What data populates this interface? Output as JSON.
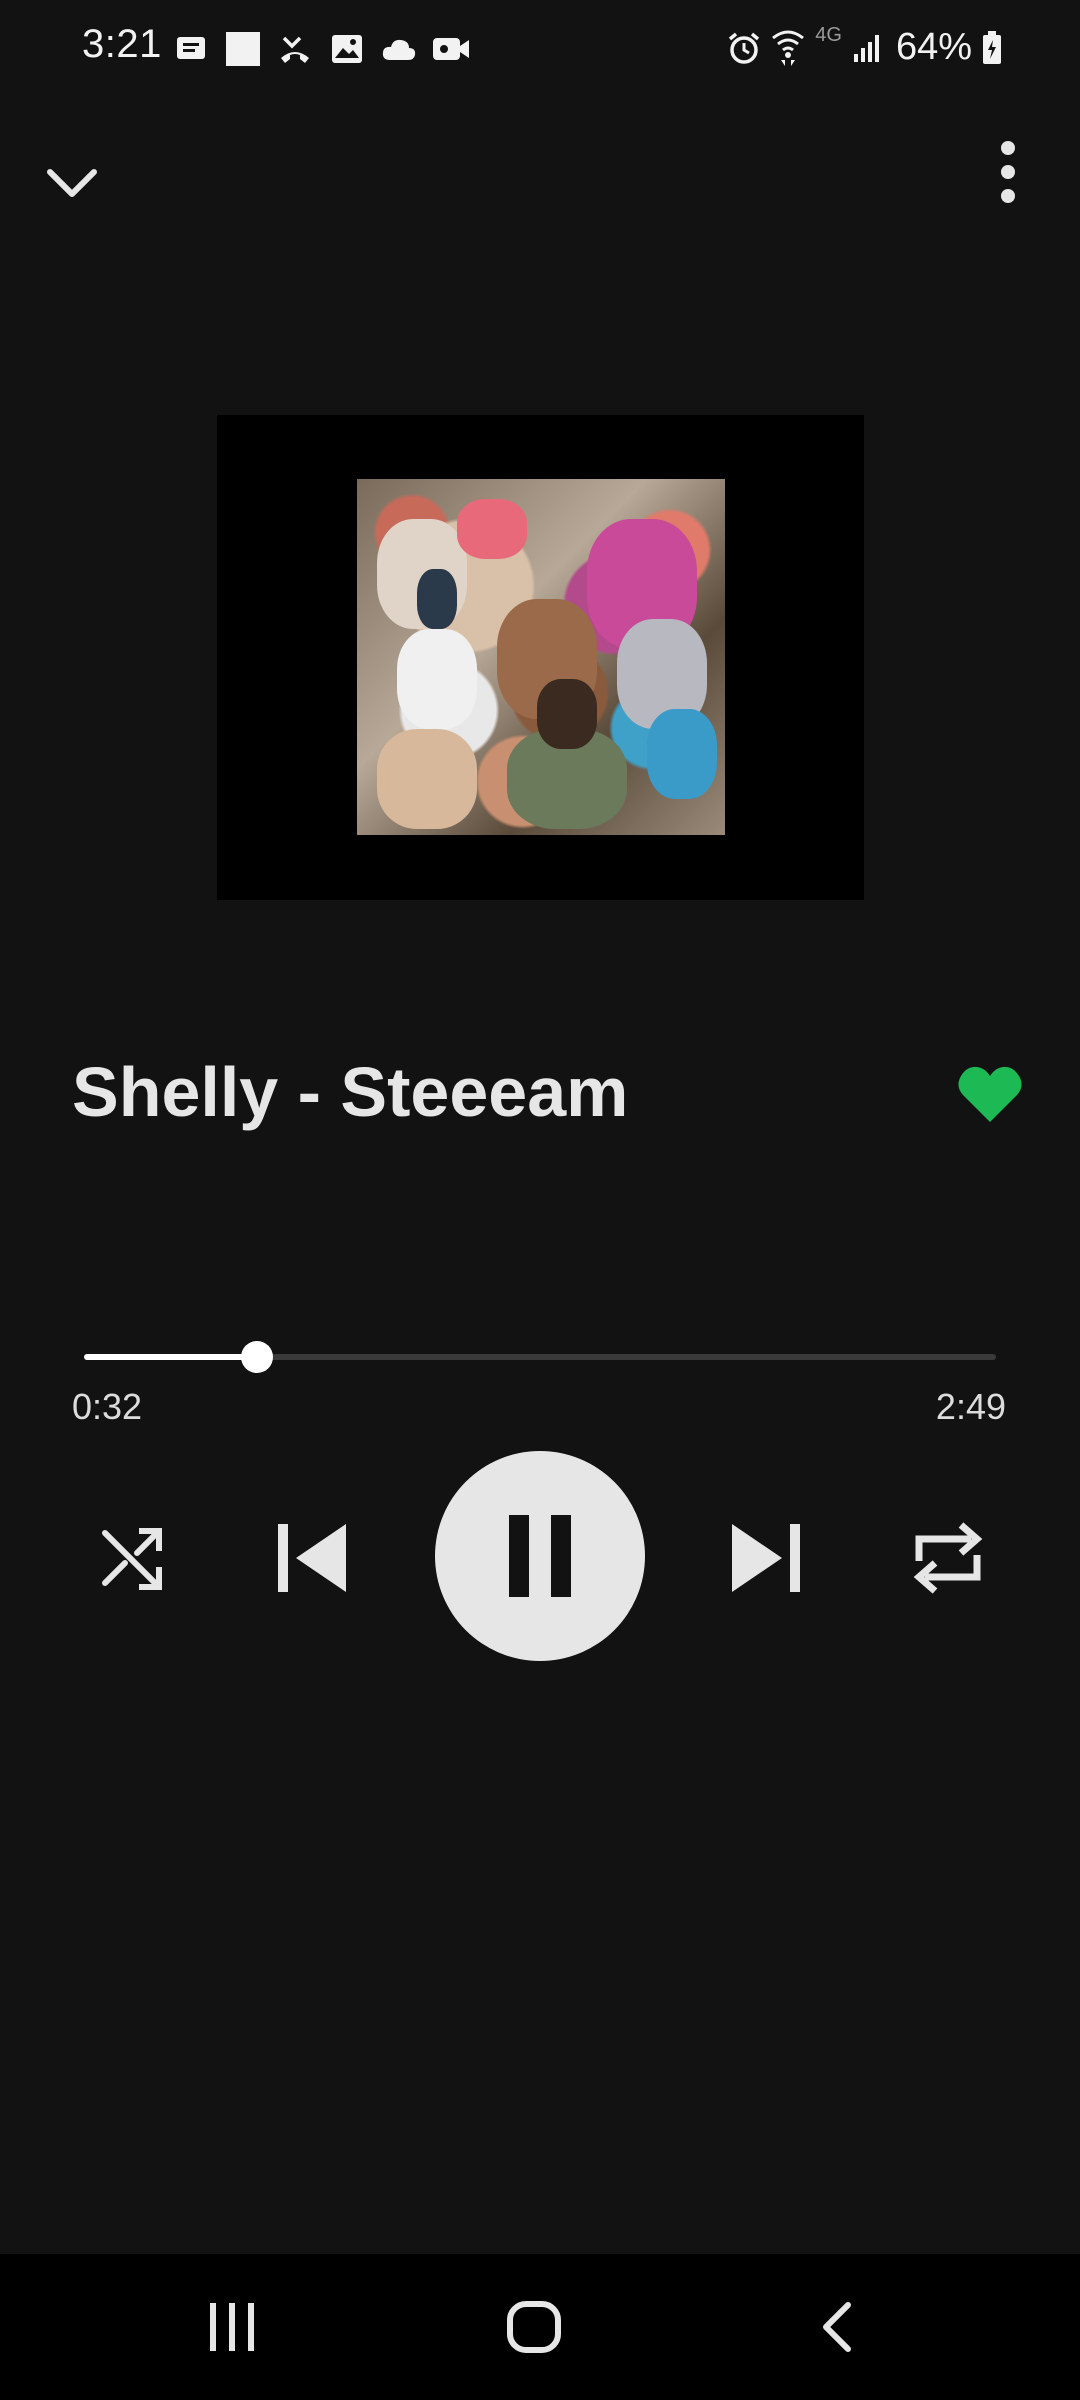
{
  "status_bar": {
    "time": "3:21",
    "notification_icons": [
      "message-icon",
      "square-icon",
      "missed-call-icon",
      "gallery-icon",
      "cloud-icon",
      "video-icon"
    ],
    "system_icons": [
      "alarm-icon",
      "wifi-icon",
      "4g-lte-icon",
      "signal-icon"
    ],
    "network_label": "4G",
    "battery_text": "64%"
  },
  "toolbar": {
    "collapse_icon": "chevron-down-icon",
    "menu_icon": "more-vert-icon"
  },
  "track": {
    "title": "Shelly - Steeeam",
    "liked": true,
    "like_color": "#1db954"
  },
  "playback": {
    "elapsed": "0:32",
    "total": "2:49",
    "progress_fraction": 0.19,
    "state": "playing"
  },
  "controls": {
    "shuffle_icon": "shuffle-icon",
    "previous_icon": "skip-previous-icon",
    "pause_icon": "pause-icon",
    "next_icon": "skip-next-icon",
    "repeat_icon": "repeat-icon"
  },
  "nav": {
    "recents_icon": "recents-icon",
    "home_icon": "home-icon",
    "back_icon": "back-icon"
  },
  "colors": {
    "background": "#121212",
    "accent": "#1db954",
    "control": "#e6e6e6"
  }
}
